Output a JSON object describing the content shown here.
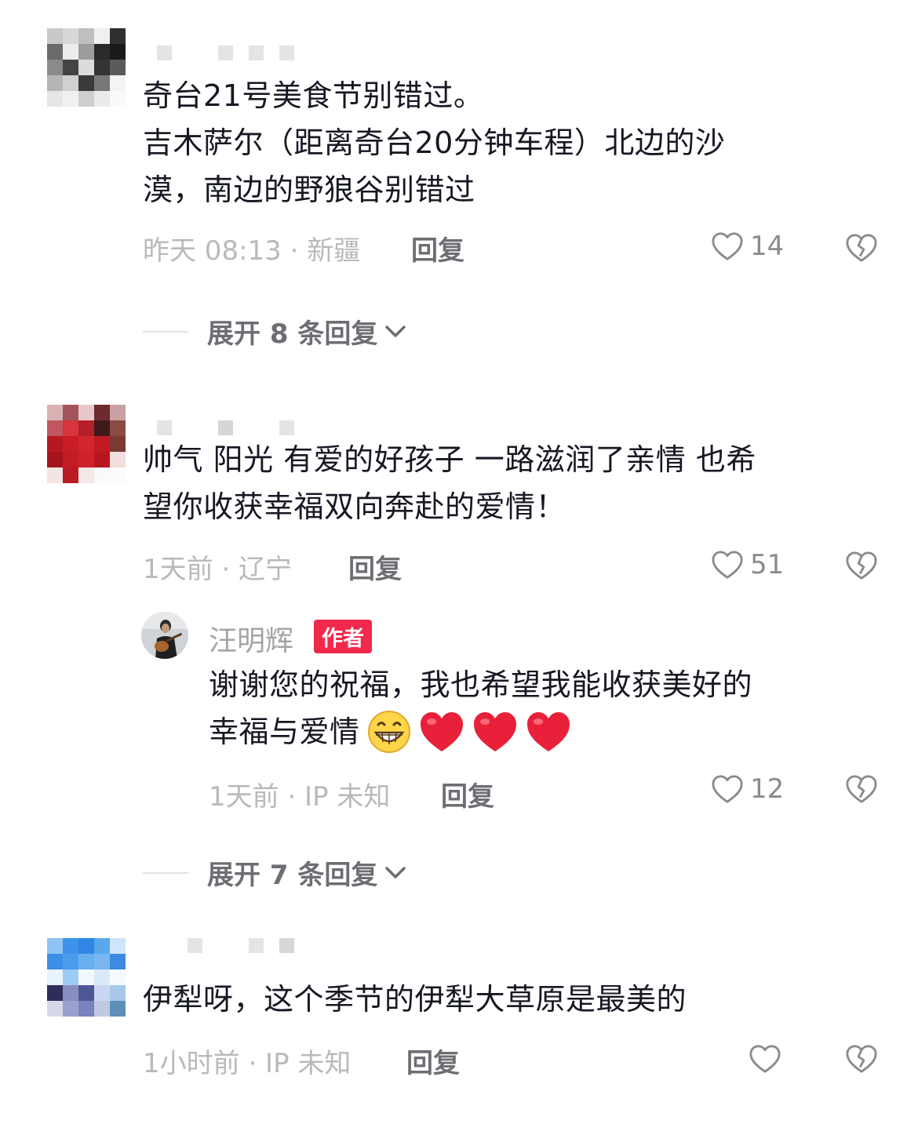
{
  "comments": [
    {
      "lines": [
        "奇台21号美食节别错过。",
        "吉木萨尔（距离奇台20分钟车程）北边的沙",
        "漠，南边的野狼谷别错过"
      ],
      "meta": "昨天 08:13 · 新疆",
      "reply_label": "回复",
      "likes": "14",
      "expand_label": "展开 8 条回复"
    },
    {
      "lines": [
        "帅气 阳光 有爱的好孩子  一路滋润了亲情  也希",
        "望你收获幸福双向奔赴的爱情！"
      ],
      "meta": "1天前 · 辽宁",
      "reply_label": "回复",
      "likes": "51",
      "reply": {
        "author": "汪明辉",
        "badge": "作者",
        "lines": [
          "谢谢您的祝福，我也希望我能收获美好的",
          "幸福与爱情"
        ],
        "meta": "1天前 · IP 未知",
        "reply_label": "回复",
        "likes": "12"
      },
      "expand_label": "展开 7 条回复"
    },
    {
      "lines": [
        "伊犁呀，这个季节的伊犁大草原是最美的"
      ],
      "meta": "1小时前 · IP 未知",
      "reply_label": "回复",
      "likes": ""
    }
  ],
  "colors": {
    "text": "#161823",
    "meta": "#b9b9bd",
    "badge": "#f2294d",
    "heart_red": "#e8203a"
  },
  "icons": [
    "heart-outline-icon",
    "broken-heart-icon",
    "chevron-down-icon",
    "grinning-emoji-icon",
    "red-heart-emoji-icon"
  ]
}
